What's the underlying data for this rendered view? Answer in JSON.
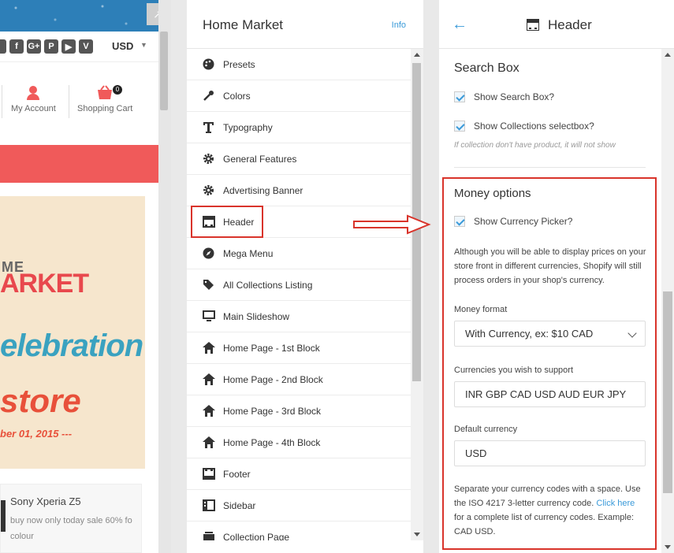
{
  "preview": {
    "currency": "USD",
    "my_account": "My Account",
    "shopping_cart": "Shopping Cart",
    "cart_count": "0",
    "banner_me": "ME",
    "banner_market": "ARKET",
    "banner_celebration": "elebration",
    "banner_store": "store",
    "banner_date": "ber 01, 2015 ---",
    "promo_title": "Sony Xperia Z5",
    "promo_text": "buy now only today sale 60% fo colour"
  },
  "menu": {
    "title": "Home Market",
    "info": "Info",
    "items": [
      {
        "label": "Presets",
        "icon": "palette-icon"
      },
      {
        "label": "Colors",
        "icon": "dropper-icon"
      },
      {
        "label": "Typography",
        "icon": "text-icon"
      },
      {
        "label": "General Features",
        "icon": "gear-icon"
      },
      {
        "label": "Advertising Banner",
        "icon": "gear-icon"
      },
      {
        "label": "Header",
        "icon": "header-icon"
      },
      {
        "label": "Mega Menu",
        "icon": "compass-icon"
      },
      {
        "label": "All Collections Listing",
        "icon": "tags-icon"
      },
      {
        "label": "Main Slideshow",
        "icon": "monitor-icon"
      },
      {
        "label": "Home Page - 1st Block",
        "icon": "home-icon"
      },
      {
        "label": "Home Page - 2nd Block",
        "icon": "home-icon"
      },
      {
        "label": "Home Page - 3rd Block",
        "icon": "home-icon"
      },
      {
        "label": "Home Page - 4th Block",
        "icon": "home-icon"
      },
      {
        "label": "Footer",
        "icon": "footer-icon"
      },
      {
        "label": "Sidebar",
        "icon": "sidebar-icon"
      },
      {
        "label": "Collection Page",
        "icon": "collection-icon"
      }
    ]
  },
  "detail": {
    "title": "Header",
    "search_box": {
      "title": "Search Box",
      "show_search_box": "Show Search Box?",
      "show_collections": "Show Collections selectbox?",
      "hint": "If collection don't have product, it will not show"
    },
    "money": {
      "title": "Money options",
      "show_currency_picker": "Show Currency Picker?",
      "description": "Although you will be able to display prices on your store front in different currencies, Shopify will still process orders in your shop's currency.",
      "money_format_label": "Money format",
      "money_format_value": "With Currency, ex: $10 CAD",
      "currencies_label": "Currencies you wish to support",
      "currencies_value": "INR GBP CAD USD AUD EUR JPY",
      "default_label": "Default currency",
      "default_value": "USD",
      "help_before": "Separate your currency codes with a space. Use the ISO 4217 3-letter currency code. ",
      "help_link": "Click here",
      "help_after": " for a complete list of currency codes. Example: CAD USD."
    }
  },
  "colors": {
    "accent": "#3a9ad9",
    "highlight": "#d9342b",
    "brand_red": "#f05a5a"
  }
}
